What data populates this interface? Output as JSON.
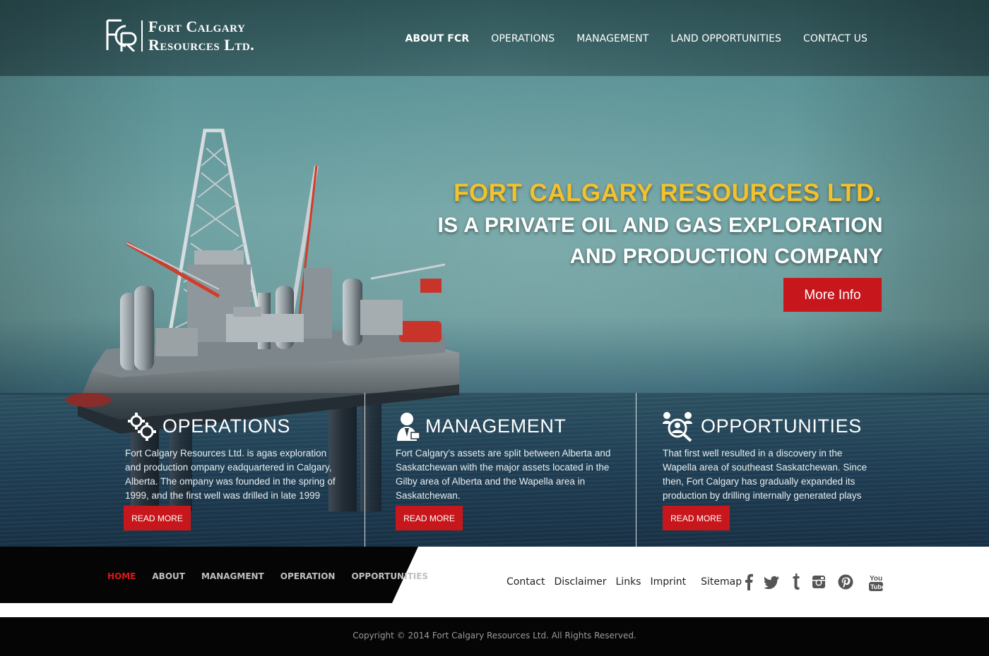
{
  "header": {
    "logo_line1": "Fort Calgary",
    "logo_line2": "Resources Ltd.",
    "nav": [
      {
        "label": "ABOUT FCR"
      },
      {
        "label": "OPERATIONS"
      },
      {
        "label": "MANAGEMENT"
      },
      {
        "label": "LAND OPPORTUNITIES"
      },
      {
        "label": "CONTACT US"
      }
    ]
  },
  "hero": {
    "title": "FORT CALGARY RESOURCES LTD.",
    "subtitle_line1": "IS A PRIVATE OIL AND GAS EXPLORATION",
    "subtitle_line2": "AND PRODUCTION COMPANY",
    "button_label": "More Info"
  },
  "features": [
    {
      "icon": "gears-icon",
      "title": "OPERATIONS",
      "text": " Fort Calgary Resources Ltd. is agas exploration and production ompany eadquartered in Calgary, Alberta. The ompany was founded in the spring of 1999, and the first well was drilled in late 1999",
      "button_label": "READ MORE"
    },
    {
      "icon": "manager-icon",
      "title": "MANAGEMENT",
      "text": "Fort Calgary’s assets are split between Alberta and Saskatchewan with the major assets located in the Gilby area of Alberta and the Wapella area in Saskatchewan.",
      "button_label": "READ MORE"
    },
    {
      "icon": "opportunities-icon",
      "title": "OPPORTUNITIES",
      "text": "That first well resulted in a discovery in the Wapella area of southeast Saskatchewan. Since then, Fort Calgary has gradually expanded its production by drilling internally generated plays",
      "button_label": "READ MORE"
    }
  ],
  "footer": {
    "links": [
      {
        "label": "HOME"
      },
      {
        "label": "ABOUT"
      },
      {
        "label": "MANAGMENT"
      },
      {
        "label": "OPERATION"
      },
      {
        "label": "OPPORTUNITIES"
      }
    ],
    "utility_links": [
      {
        "label": "Contact"
      },
      {
        "label": "Disclaimer"
      },
      {
        "label": "Links"
      },
      {
        "label": "Imprint"
      },
      {
        "label": "Sitemap"
      }
    ],
    "social": [
      "facebook-icon",
      "twitter-icon",
      "tumblr-icon",
      "instagram-icon",
      "pinterest-icon",
      "youtube-icon"
    ],
    "copyright": "Copyright © 2014 Fort Calgary Resources Ltd. All Rights Reserved."
  },
  "colors": {
    "accent_red": "#c8171c",
    "active_red": "#e0151b",
    "title_yellow": "#f2c12e"
  }
}
